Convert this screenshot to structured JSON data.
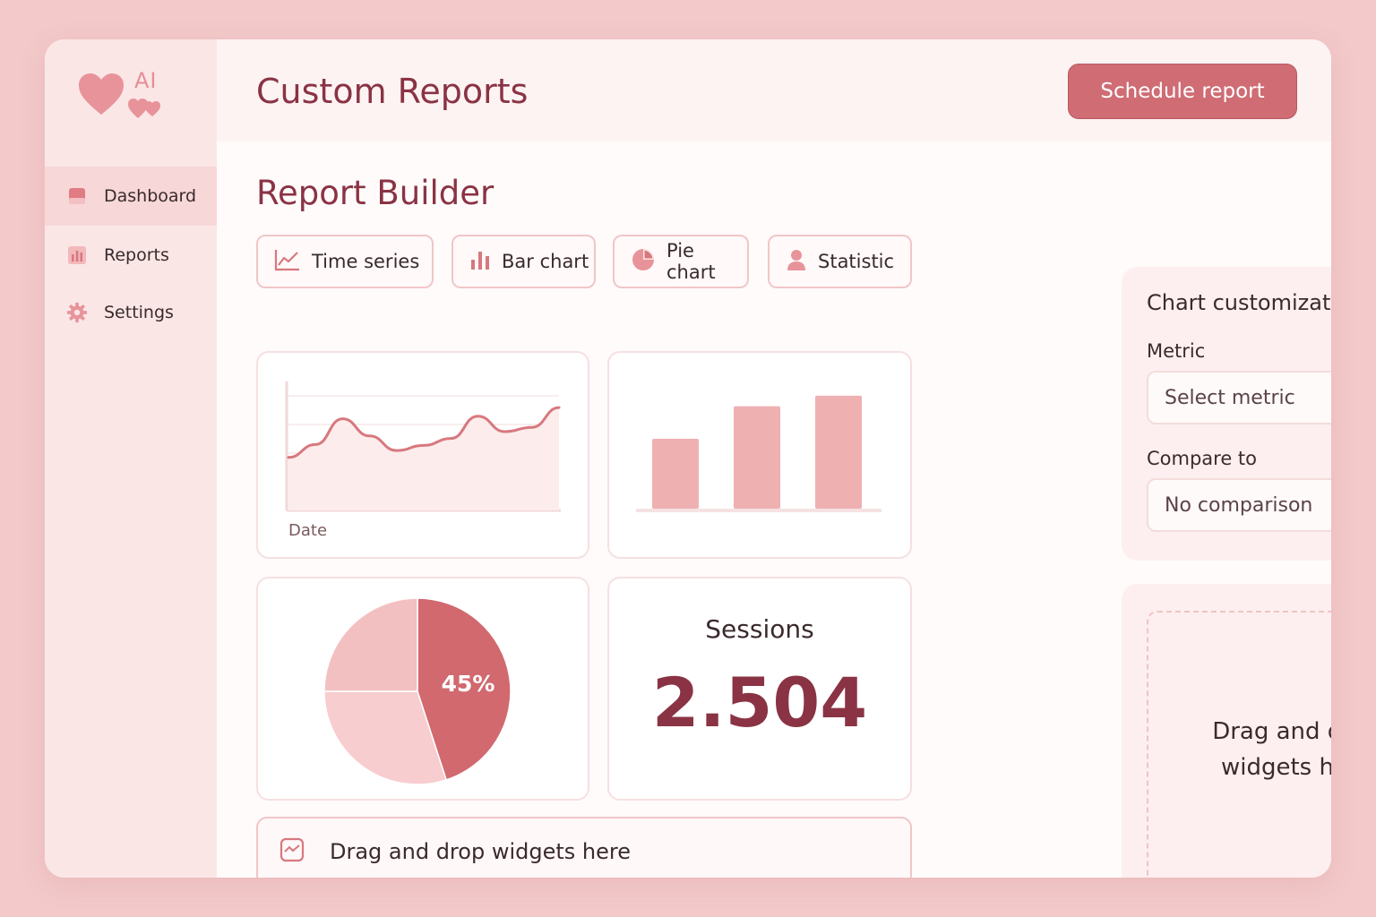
{
  "app": {
    "logo_text": "AI",
    "title": "Custom Reports",
    "schedule_label": "Schedule report"
  },
  "colors": {
    "accent": "#cf6c74",
    "title": "#8a3344",
    "pie_primary": "#d1696f",
    "pie_secondary": "#f3c0c2",
    "pie_tertiary": "#f7cdcf",
    "bar": "#efb0b2",
    "line": "#d7787e"
  },
  "sidebar": {
    "items": [
      {
        "label": "Dashboard",
        "icon": "dashboard-icon",
        "active": true
      },
      {
        "label": "Reports",
        "icon": "bar-chart-icon",
        "active": false
      },
      {
        "label": "Settings",
        "icon": "gear-icon",
        "active": false
      }
    ]
  },
  "builder": {
    "title": "Report Builder",
    "chart_types": [
      {
        "label": "Time series",
        "icon": "line-chart-icon"
      },
      {
        "label": "Bar chart",
        "icon": "bar-chart-icon"
      },
      {
        "label": "Pie chart",
        "icon": "pie-chart-icon"
      },
      {
        "label": "Statistic",
        "icon": "user-icon"
      }
    ],
    "dropbar_label": "Drag and drop widgets here"
  },
  "chart_data": [
    {
      "type": "line",
      "xlabel": "Date",
      "values": [
        0.2,
        0.35,
        0.65,
        0.45,
        0.28,
        0.34,
        0.42,
        0.68,
        0.5,
        0.55,
        0.78
      ]
    },
    {
      "type": "bar",
      "values": [
        0.6,
        0.88,
        0.97
      ]
    },
    {
      "type": "pie",
      "slices": [
        {
          "value": 45,
          "label": "45%"
        },
        {
          "value": 30,
          "label": ""
        },
        {
          "value": 25,
          "label": ""
        }
      ]
    }
  ],
  "stat": {
    "label": "Sessions",
    "value": "2.504"
  },
  "customization": {
    "title": "Chart customization",
    "metric_label": "Metric",
    "metric_value": "Select metric",
    "compare_label": "Compare to",
    "compare_value": "No comparison"
  },
  "drop_panel": {
    "label": "Drag and drop widgets here"
  }
}
